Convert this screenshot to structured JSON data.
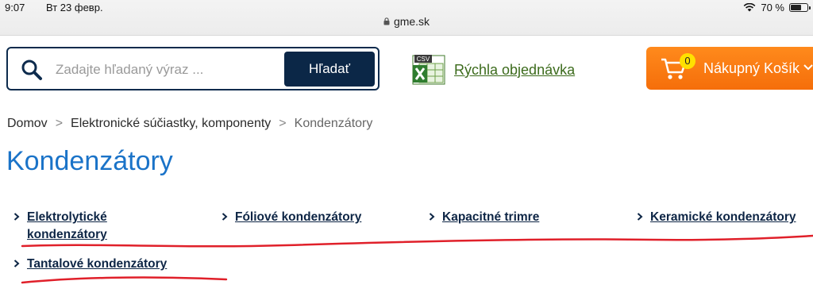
{
  "status_bar": {
    "time": "9:07",
    "date": "Вт 23 февр.",
    "battery": "70 %",
    "battery_level": 0.7,
    "url": "gme.sk"
  },
  "header": {
    "search_placeholder": "Zadajte hľadaný výraz ...",
    "search_button": "Hľadať",
    "quick_order_label": "Rýchla objednávka",
    "csv_label": "CSV",
    "cart_label": "Nákupný Košík",
    "cart_count": "0"
  },
  "breadcrumb": {
    "home": "Domov",
    "category": "Elektronické súčiastky, komponenty",
    "current": "Kondenzátory",
    "separator": ">"
  },
  "page_title": "Kondenzátory",
  "categories": [
    "Elektrolytické kondenzátory",
    "Fóliové kondenzátory",
    "Kapacitné trimre",
    "Keramické kondenzátory",
    "Tantalové kondenzátory"
  ],
  "colors": {
    "title_blue": "#1a73c8",
    "link_navy": "#0d2545",
    "search_button_bg": "#0b2747",
    "cart_orange": "#f77d14",
    "quick_order_green": "#3c6b1c",
    "annotation_red": "#e0202a"
  }
}
